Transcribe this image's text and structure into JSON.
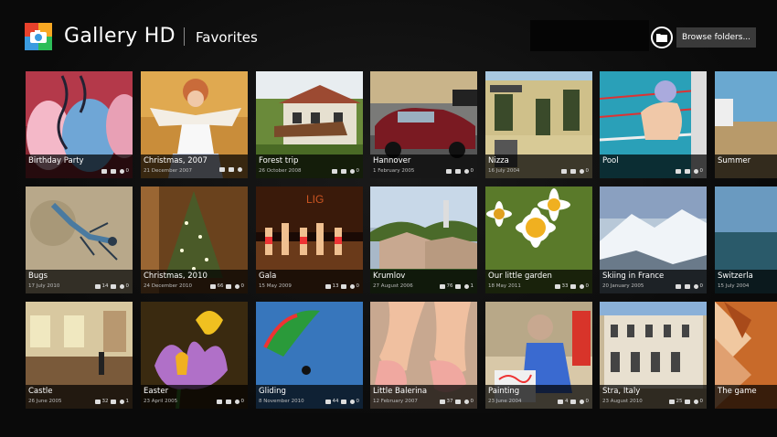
{
  "header": {
    "app_title": "Gallery HD",
    "section": "Favorites",
    "browse_label": "Browse folders...",
    "logo_colors": [
      "#e8412c",
      "#f7a823",
      "#3b9be0",
      "#2dbd59"
    ]
  },
  "albums": [
    {
      "title": "Birthday Party",
      "date": "",
      "photos": "",
      "comments": "",
      "likes": "0",
      "theme": "party"
    },
    {
      "title": "Christmas, 2007",
      "date": "21 December 2007",
      "photos": "",
      "comments": "",
      "likes": "",
      "theme": "angel"
    },
    {
      "title": "Forest trip",
      "date": "26 October 2008",
      "photos": "",
      "comments": "",
      "likes": "0",
      "theme": "house"
    },
    {
      "title": "Hannover",
      "date": "1 February 2005",
      "photos": "",
      "comments": "",
      "likes": "0",
      "theme": "car"
    },
    {
      "title": "Nizza",
      "date": "16 July 2004",
      "photos": "",
      "comments": "",
      "likes": "0",
      "theme": "building"
    },
    {
      "title": "Pool",
      "date": "",
      "photos": "",
      "comments": "",
      "likes": "0",
      "theme": "pool"
    },
    {
      "title": "Summer",
      "date": "",
      "photos": "",
      "comments": "",
      "likes": "",
      "theme": "beach"
    },
    {
      "title": "Bugs",
      "date": "17 July 2010",
      "photos": "14",
      "comments": "",
      "likes": "0",
      "theme": "bug"
    },
    {
      "title": "Christmas, 2010",
      "date": "24 December 2010",
      "photos": "66",
      "comments": "",
      "likes": "0",
      "theme": "tree"
    },
    {
      "title": "Gala",
      "date": "15 May 2009",
      "photos": "13",
      "comments": "",
      "likes": "0",
      "theme": "stage"
    },
    {
      "title": "Krumlov",
      "date": "27 August 2006",
      "photos": "76",
      "comments": "",
      "likes": "1",
      "theme": "town"
    },
    {
      "title": "Our little garden",
      "date": "18 May 2011",
      "photos": "33",
      "comments": "",
      "likes": "0",
      "theme": "daisy"
    },
    {
      "title": "Skiing in France",
      "date": "20 January 2005",
      "photos": "",
      "comments": "",
      "likes": "0",
      "theme": "snow"
    },
    {
      "title": "Switzerla",
      "date": "15 July 2004",
      "photos": "",
      "comments": "",
      "likes": "",
      "theme": "lake"
    },
    {
      "title": "Castle",
      "date": "26 June 2005",
      "photos": "32",
      "comments": "",
      "likes": "1",
      "theme": "castle"
    },
    {
      "title": "Easter",
      "date": "23 April 2005",
      "photos": "",
      "comments": "",
      "likes": "0",
      "theme": "crocus"
    },
    {
      "title": "Gliding",
      "date": "8 November 2010",
      "photos": "44",
      "comments": "",
      "likes": "0",
      "theme": "glider"
    },
    {
      "title": "Little Balerina",
      "date": "12 February 2007",
      "photos": "37",
      "comments": "",
      "likes": "0",
      "theme": "feet"
    },
    {
      "title": "Painting",
      "date": "23 June 2004",
      "photos": "4",
      "comments": "",
      "likes": "0",
      "theme": "paint"
    },
    {
      "title": "Stra, Italy",
      "date": "23 August 2010",
      "photos": "25",
      "comments": "",
      "likes": "0",
      "theme": "palace"
    },
    {
      "title": "The game",
      "date": "",
      "photos": "",
      "comments": "",
      "likes": "",
      "theme": "game"
    }
  ]
}
